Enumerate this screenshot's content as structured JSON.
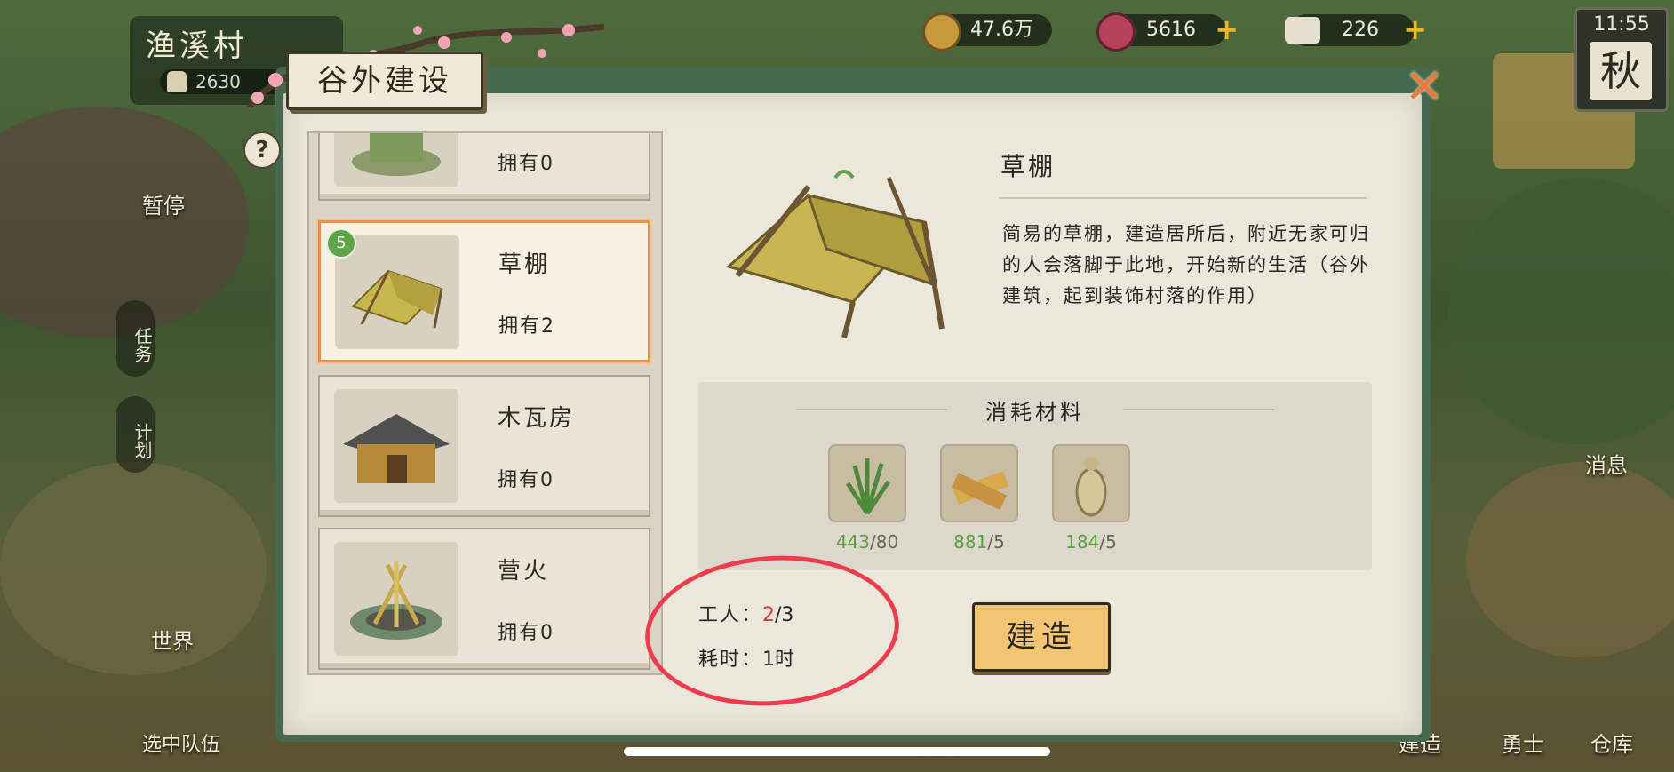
{
  "hud": {
    "village_name": "渔溪村",
    "population": "2630",
    "resources": [
      {
        "icon": "coin-icon",
        "value": "47.6万",
        "has_plus": false
      },
      {
        "icon": "gem-icon",
        "value": "5616",
        "has_plus": true
      },
      {
        "icon": "ticket-icon",
        "value": "226",
        "has_plus": true
      }
    ],
    "time": "11:55",
    "season": "秋"
  },
  "left_menu": {
    "pause": "暂停",
    "quest": "任务",
    "plan": "计划",
    "world": "世界",
    "team": "选中队伍"
  },
  "right_menu": {
    "message": "消息",
    "build": "建造",
    "hero": "勇士",
    "storage": "仓库"
  },
  "dialog": {
    "title": "谷外建设",
    "help": "?",
    "close": "✕"
  },
  "list": [
    {
      "name": "",
      "owned": "拥有0",
      "badge": ""
    },
    {
      "name": "草棚",
      "owned": "拥有2",
      "badge": "5"
    },
    {
      "name": "木瓦房",
      "owned": "拥有0",
      "badge": ""
    },
    {
      "name": "营火",
      "owned": "拥有0",
      "badge": ""
    }
  ],
  "detail": {
    "name": "草棚",
    "description": "简易的草棚，建造居所后，附近无家可归的人会落脚于此地，开始新的生活（谷外建筑，起到装饰村落的作用）",
    "materials_title": "消耗材料",
    "materials": [
      {
        "icon": "grass-icon",
        "have": "443",
        "need": "/80"
      },
      {
        "icon": "wood-plank-icon",
        "have": "881",
        "need": "/5"
      },
      {
        "icon": "rope-icon",
        "have": "184",
        "need": "/5"
      }
    ],
    "workers_label": "工人：",
    "workers_current": "2",
    "workers_total": "/3",
    "time_label": "耗时：",
    "time_value": "1时",
    "build_button": "建造"
  },
  "colors": {
    "accent_orange": "#e9904c",
    "have_green": "#59a043",
    "highlight_red": "#ee3b4d",
    "build_button": "#f2c574"
  }
}
